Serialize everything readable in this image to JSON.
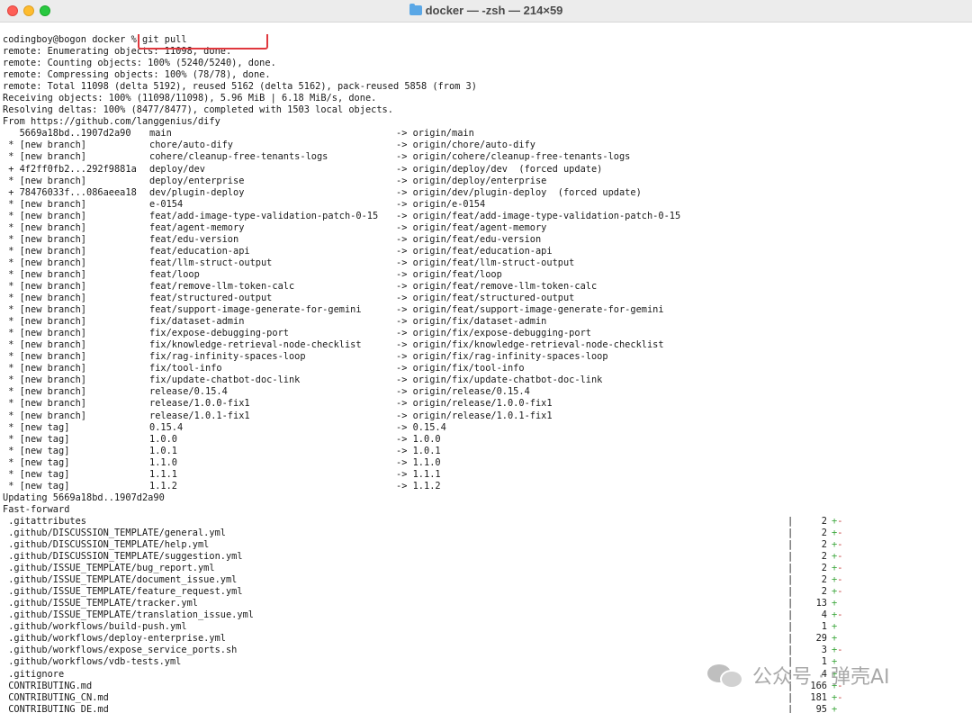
{
  "window": {
    "title": "docker — -zsh — 214×59",
    "folder_icon": "folder-icon"
  },
  "prompt": {
    "text": "codingboy@bogon docker % ",
    "command": "git pull"
  },
  "remote_lines": [
    "remote: Enumerating objects: 11098, done.",
    "remote: Counting objects: 100% (5240/5240), done.",
    "remote: Compressing objects: 100% (78/78), done.",
    "remote: Total 11098 (delta 5192), reused 5162 (delta 5162), pack-reused 5858 (from 3)",
    "Receiving objects: 100% (11098/11098), 5.96 MiB | 6.18 MiB/s, done.",
    "Resolving deltas: 100% (8477/8477), completed with 1503 local objects.",
    "From https://github.com/langgenius/dify"
  ],
  "refs": [
    {
      "flag": "   5669a18bd..1907d2a90",
      "name": "main",
      "target": "-> origin/main"
    },
    {
      "flag": " * [new branch]",
      "name": "chore/auto-dify",
      "target": "-> origin/chore/auto-dify"
    },
    {
      "flag": " * [new branch]",
      "name": "cohere/cleanup-free-tenants-logs",
      "target": "-> origin/cohere/cleanup-free-tenants-logs"
    },
    {
      "flag": " + 4f2ff0fb2...292f9881a",
      "name": "deploy/dev",
      "target": "-> origin/deploy/dev  (forced update)"
    },
    {
      "flag": " * [new branch]",
      "name": "deploy/enterprise",
      "target": "-> origin/deploy/enterprise"
    },
    {
      "flag": " + 78476033f...086aeea18",
      "name": "dev/plugin-deploy",
      "target": "-> origin/dev/plugin-deploy  (forced update)"
    },
    {
      "flag": " * [new branch]",
      "name": "e-0154",
      "target": "-> origin/e-0154"
    },
    {
      "flag": " * [new branch]",
      "name": "feat/add-image-type-validation-patch-0-15",
      "target": "-> origin/feat/add-image-type-validation-patch-0-15"
    },
    {
      "flag": " * [new branch]",
      "name": "feat/agent-memory",
      "target": "-> origin/feat/agent-memory"
    },
    {
      "flag": " * [new branch]",
      "name": "feat/edu-version",
      "target": "-> origin/feat/edu-version"
    },
    {
      "flag": " * [new branch]",
      "name": "feat/education-api",
      "target": "-> origin/feat/education-api"
    },
    {
      "flag": " * [new branch]",
      "name": "feat/llm-struct-output",
      "target": "-> origin/feat/llm-struct-output"
    },
    {
      "flag": " * [new branch]",
      "name": "feat/loop",
      "target": "-> origin/feat/loop"
    },
    {
      "flag": " * [new branch]",
      "name": "feat/remove-llm-token-calc",
      "target": "-> origin/feat/remove-llm-token-calc"
    },
    {
      "flag": " * [new branch]",
      "name": "feat/structured-output",
      "target": "-> origin/feat/structured-output"
    },
    {
      "flag": " * [new branch]",
      "name": "feat/support-image-generate-for-gemini",
      "target": "-> origin/feat/support-image-generate-for-gemini"
    },
    {
      "flag": " * [new branch]",
      "name": "fix/dataset-admin",
      "target": "-> origin/fix/dataset-admin"
    },
    {
      "flag": " * [new branch]",
      "name": "fix/expose-debugging-port",
      "target": "-> origin/fix/expose-debugging-port"
    },
    {
      "flag": " * [new branch]",
      "name": "fix/knowledge-retrieval-node-checklist",
      "target": "-> origin/fix/knowledge-retrieval-node-checklist"
    },
    {
      "flag": " * [new branch]",
      "name": "fix/rag-infinity-spaces-loop",
      "target": "-> origin/fix/rag-infinity-spaces-loop"
    },
    {
      "flag": " * [new branch]",
      "name": "fix/tool-info",
      "target": "-> origin/fix/tool-info"
    },
    {
      "flag": " * [new branch]",
      "name": "fix/update-chatbot-doc-link",
      "target": "-> origin/fix/update-chatbot-doc-link"
    },
    {
      "flag": " * [new branch]",
      "name": "release/0.15.4",
      "target": "-> origin/release/0.15.4"
    },
    {
      "flag": " * [new branch]",
      "name": "release/1.0.0-fix1",
      "target": "-> origin/release/1.0.0-fix1"
    },
    {
      "flag": " * [new branch]",
      "name": "release/1.0.1-fix1",
      "target": "-> origin/release/1.0.1-fix1"
    },
    {
      "flag": " * [new tag]",
      "name": "0.15.4",
      "target": "-> 0.15.4"
    },
    {
      "flag": " * [new tag]",
      "name": "1.0.0",
      "target": "-> 1.0.0"
    },
    {
      "flag": " * [new tag]",
      "name": "1.0.1",
      "target": "-> 1.0.1"
    },
    {
      "flag": " * [new tag]",
      "name": "1.1.0",
      "target": "-> 1.1.0"
    },
    {
      "flag": " * [new tag]",
      "name": "1.1.1",
      "target": "-> 1.1.1"
    },
    {
      "flag": " * [new tag]",
      "name": "1.1.2",
      "target": "-> 1.1.2"
    }
  ],
  "update_lines": [
    "Updating 5669a18bd..1907d2a90",
    "Fast-forward"
  ],
  "diffstat": [
    {
      "file": " .gitattributes",
      "count": "2",
      "plus": "+",
      "minus": "-"
    },
    {
      "file": " .github/DISCUSSION_TEMPLATE/general.yml",
      "count": "2",
      "plus": "+",
      "minus": "-"
    },
    {
      "file": " .github/DISCUSSION_TEMPLATE/help.yml",
      "count": "2",
      "plus": "+",
      "minus": "-"
    },
    {
      "file": " .github/DISCUSSION_TEMPLATE/suggestion.yml",
      "count": "2",
      "plus": "+",
      "minus": "-"
    },
    {
      "file": " .github/ISSUE_TEMPLATE/bug_report.yml",
      "count": "2",
      "plus": "+",
      "minus": "-"
    },
    {
      "file": " .github/ISSUE_TEMPLATE/document_issue.yml",
      "count": "2",
      "plus": "+",
      "minus": "-"
    },
    {
      "file": " .github/ISSUE_TEMPLATE/feature_request.yml",
      "count": "2",
      "plus": "+",
      "minus": "-"
    },
    {
      "file": " .github/ISSUE_TEMPLATE/tracker.yml",
      "count": "13",
      "plus": "+",
      "minus": ""
    },
    {
      "file": " .github/ISSUE_TEMPLATE/translation_issue.yml",
      "count": "4",
      "plus": "+",
      "minus": "-"
    },
    {
      "file": " .github/workflows/build-push.yml",
      "count": "1",
      "plus": "+",
      "minus": ""
    },
    {
      "file": " .github/workflows/deploy-enterprise.yml",
      "count": "29",
      "plus": "+",
      "minus": ""
    },
    {
      "file": " .github/workflows/expose_service_ports.sh",
      "count": "3",
      "plus": "+",
      "minus": "-"
    },
    {
      "file": " .github/workflows/vdb-tests.yml",
      "count": "1",
      "plus": "+",
      "minus": ""
    },
    {
      "file": " .gitignore",
      "count": "4",
      "plus": "+",
      "minus": ""
    },
    {
      "file": " CONTRIBUTING.md",
      "count": "166",
      "plus": "+",
      "minus": "-"
    },
    {
      "file": " CONTRIBUTING_CN.md",
      "count": "181",
      "plus": "+",
      "minus": "-"
    },
    {
      "file": " CONTRIBUTING_DE.md",
      "count": "95",
      "plus": "+",
      "minus": ""
    }
  ],
  "watermark": {
    "text": "公众号 · 弹壳AI",
    "icon": "wechat-icon"
  }
}
